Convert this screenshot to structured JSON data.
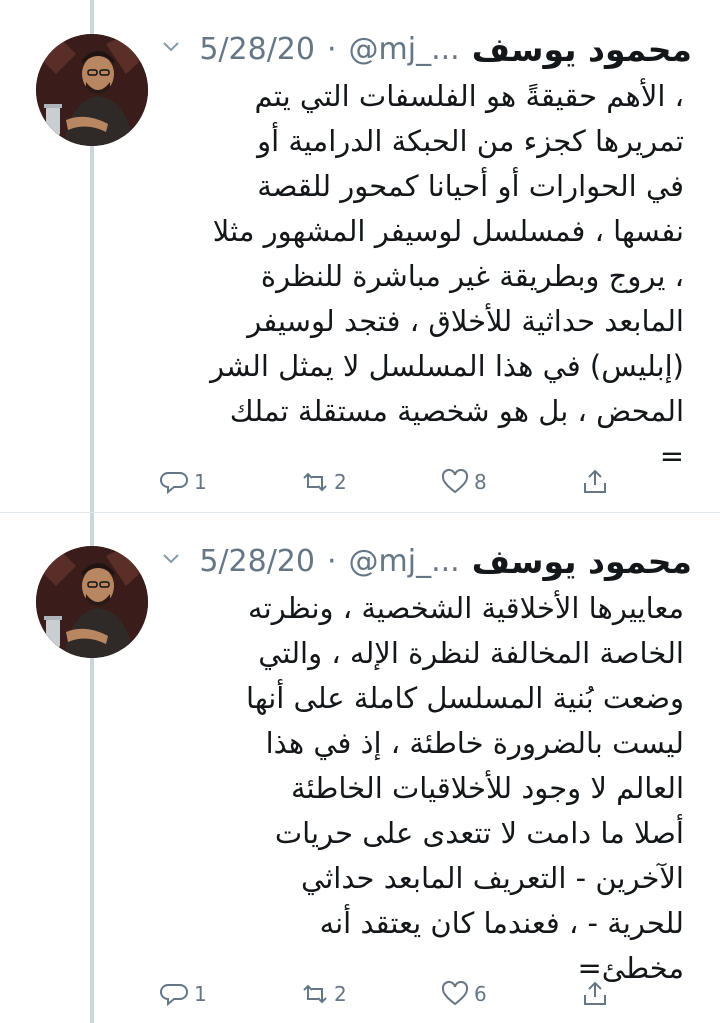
{
  "tweets": [
    {
      "display_name": "محمود يوسف",
      "handle": "@mj_...",
      "dot": "·",
      "date": "5/28/20",
      "text": "، الأهم حقيقةً هو الفلسفات التي يتم\nتمريرها كجزء من الحبكة الدرامية أو\nفي الحوارات أو أحيانا كمحور للقصة\nنفسها ، فمسلسل لوسيفر المشهور مثلا\n، يروج وبطريقة غير مباشرة للنظرة\nالمابعد حداثية للأخلاق ، فتجد لوسيفر\n(إبليس) في هذا المسلسل لا يمثل الشر\nالمحض ، بل هو شخصية مستقلة تملك\n=",
      "replies": "1",
      "retweets": "2",
      "likes": "8"
    },
    {
      "display_name": "محمود يوسف",
      "handle": "@mj_...",
      "dot": "·",
      "date": "5/28/20",
      "text": "معاييرها الأخلاقية الشخصية ، ونظرته\nالخاصة المخالفة لنظرة الإله ، والتي\nوضعت بُنية المسلسل كاملة على أنها\nليست بالضرورة خاطئة ، إذ في هذا\nالعالم لا وجود للأخلاقيات الخاطئة\nأصلا ما دامت لا تتعدى على حريات\nالآخرين - التعريف المابعد حداثي\nللحرية - ، فعندما كان يعتقد أنه\nمخطئ=",
      "replies": "1",
      "retweets": "2",
      "likes": "6"
    }
  ],
  "icons": {
    "reply": "reply-icon",
    "retweet": "retweet-icon",
    "like": "heart-icon",
    "share": "share-icon",
    "menu": "chevron-down-icon"
  },
  "colors": {
    "text": "#14171a",
    "secondary": "#657786",
    "thread_line": "#ccd6dd"
  }
}
